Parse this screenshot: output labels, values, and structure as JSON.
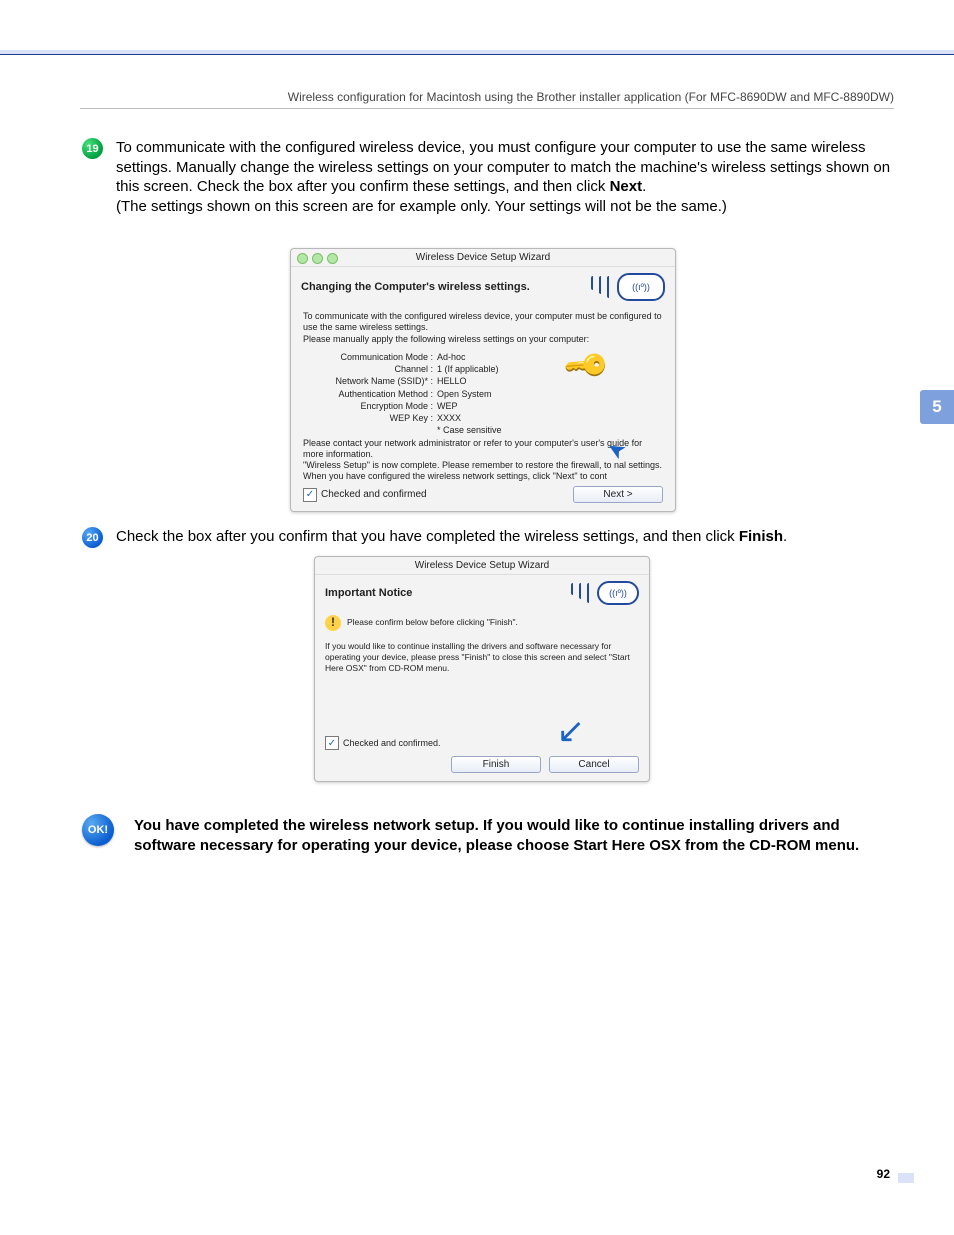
{
  "header": "Wireless configuration for Macintosh using the Brother installer application (For MFC-8690DW and MFC-8890DW)",
  "step19": {
    "num": "19",
    "text_a": "To communicate with the configured wireless device, you must configure your computer to use the same wireless settings. Manually change the wireless settings on your computer to match the machine's wireless settings shown on this screen. Check the box after you confirm these settings, and then click ",
    "text_b": "Next",
    "text_c": ".",
    "text_d": "(The settings shown on this screen are for example only. Your settings will not be the same.)"
  },
  "dialog1": {
    "title": "Wireless Device Setup Wizard",
    "heading": "Changing the Computer's wireless settings.",
    "intro1": "To communicate with the configured wireless device, your computer must be configured to use the same wireless settings.",
    "intro2": "Please manually apply the following wireless settings on your computer:",
    "rows": {
      "comm_mode_k": "Communication Mode :",
      "comm_mode_v": "Ad-hoc",
      "channel_k": "Channel :",
      "channel_v": "1   (If applicable)",
      "ssid_k": "Network Name (SSID)* :",
      "ssid_v": "HELLO",
      "auth_k": "Authentication Method :",
      "auth_v": "Open System",
      "enc_k": "Encryption Mode :",
      "enc_v": "WEP",
      "wep_k": "WEP Key :",
      "wep_v": "XXXX"
    },
    "case_note": "* Case sensitive",
    "contact": "Please contact your network administrator or refer to your computer's user's guide for more information.",
    "complete": "\"Wireless Setup\" is now complete. Please remember to restore the firewall, to           nal settings. When you have configured the wireless network settings, click \"Next\" to cont",
    "checkbox": "Checked and confirmed",
    "next_btn": "Next >"
  },
  "step20": {
    "num": "20",
    "text_a": "Check the box after you confirm that you have completed the wireless settings, and then click ",
    "text_b": "Finish",
    "text_c": "."
  },
  "dialog2": {
    "title": "Wireless Device Setup Wizard",
    "heading": "Important Notice",
    "confirm_line": "Please confirm below before clicking \"Finish\".",
    "body": "If you would like to continue installing the drivers and software necessary for operating your device, please press \"Finish\" to close this screen and select \"Start Here OSX\" from CD-ROM menu.",
    "checkbox": "Checked and confirmed.",
    "finish_btn": "Finish",
    "cancel_btn": "Cancel"
  },
  "ok_label": "OK!",
  "final_text": "You have completed the wireless network setup. If you would like to continue installing drivers and software necessary for operating your device, please choose Start Here OSX from the CD-ROM menu.",
  "side_tab": "5",
  "page_number": "92"
}
